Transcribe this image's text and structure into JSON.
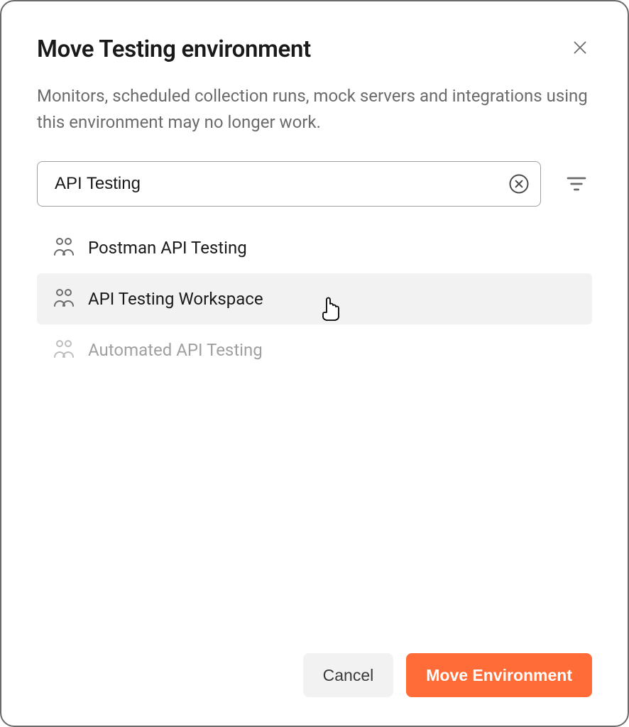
{
  "dialog": {
    "title": "Move Testing environment",
    "description": "Monitors, scheduled collection runs, mock servers and integrations using this environment may no longer work.",
    "search": {
      "value": "API Testing"
    },
    "results": [
      {
        "label": "Postman API Testing",
        "state": "normal"
      },
      {
        "label": "API Testing Workspace",
        "state": "hovered"
      },
      {
        "label": "Automated API Testing",
        "state": "disabled"
      }
    ],
    "footer": {
      "cancel_label": "Cancel",
      "primary_label": "Move Environment"
    }
  }
}
